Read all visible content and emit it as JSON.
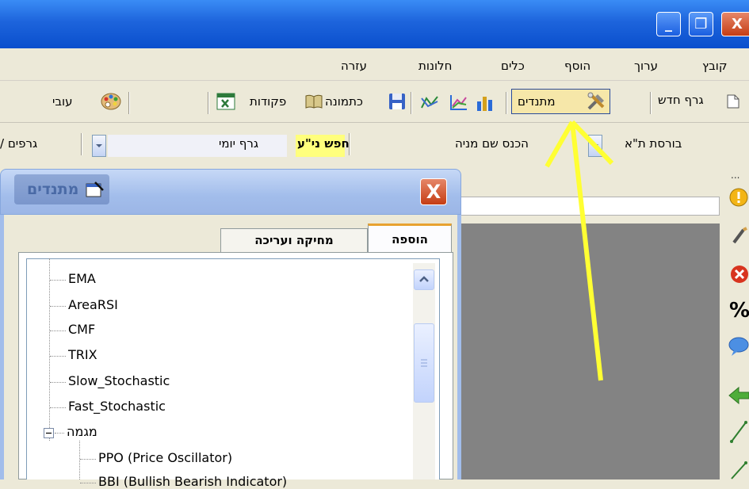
{
  "window": {
    "minimize_glyph": "_",
    "maximize_glyph": "❐",
    "close_glyph": "X"
  },
  "menu": {
    "file": "קובץ",
    "edit": "ערוך",
    "add": "הוסף",
    "tools": "כלים",
    "windows": "חלונות",
    "help": "עזרה"
  },
  "toolbar": {
    "new_chart": "גרף חדש",
    "oscillators": "מתנדים",
    "picture": "כתמונה",
    "commands": "פקודות",
    "work": "עובי"
  },
  "toolbar2": {
    "exchange": "בורסת ת\"א",
    "enter_stock_name": "הכנס שם מניה",
    "search_security": "חפש ני\"ע",
    "daily_chart": "גרף יומי",
    "charts": "גרפים /"
  },
  "dialog": {
    "title": "מתנדים",
    "tabs": {
      "add": "הוספה",
      "delete_edit": "מחיקה ועריכה"
    },
    "tree": {
      "items": [
        "EMA",
        "AreaRSI",
        "CMF",
        "TRIX",
        "Slow_Stochastic",
        "Fast_Stochastic"
      ],
      "group": "מגמה",
      "children": [
        "PPO (Price Oscillator)",
        "BBI (Bullish Bearish Indicator)"
      ]
    }
  },
  "right_panel": {
    "percent": "%",
    "dots": "..."
  },
  "colors": {
    "titlebar": "#0a4fcd",
    "highlight_yellow": "#ffff7c",
    "arrow_yellow": "#ffff33",
    "workspace_gray": "#838383"
  }
}
